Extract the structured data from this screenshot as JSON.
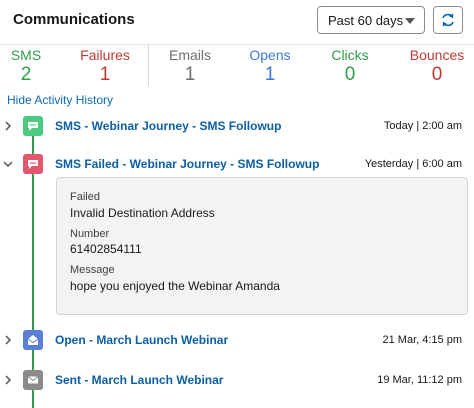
{
  "header": {
    "title": "Communications",
    "period_label": "Past 60 days"
  },
  "stats": [
    {
      "label": "SMS",
      "value": "2",
      "color": "#2e9e4b"
    },
    {
      "label": "Failures",
      "value": "1",
      "color": "#c23934"
    },
    {
      "label": "Emails",
      "value": "1",
      "color": "#706e6b"
    },
    {
      "label": "Opens",
      "value": "1",
      "color": "#3c78d8"
    },
    {
      "label": "Clicks",
      "value": "0",
      "color": "#2e9e4b"
    },
    {
      "label": "Bounces",
      "value": "0",
      "color": "#c23934"
    }
  ],
  "hide_link": "Hide Activity History",
  "activities": [
    {
      "title": "SMS - Webinar Journey - SMS Followup",
      "time": "Today | 2:00 am",
      "icon": "sms-icon",
      "color": "#4bca81",
      "expanded": false
    },
    {
      "title": "SMS Failed - Webinar Journey - SMS Followup",
      "time": "Yesterday | 6:00 am",
      "icon": "sms-failed-icon",
      "color": "#e3566b",
      "expanded": true
    },
    {
      "title": "Open - March Launch Webinar",
      "time": "21 Mar, 4:15 pm",
      "icon": "email-open-icon",
      "color": "#5b7fd6",
      "expanded": false
    },
    {
      "title": "Sent - March Launch Webinar",
      "time": "19 Mar, 11:12 pm",
      "icon": "email-icon",
      "color": "#8a8a8a",
      "expanded": false
    }
  ],
  "detail": {
    "status_label": "Failed",
    "status_value": "Invalid Destination Address",
    "number_label": "Number",
    "number_value": "61402854111",
    "message_label": "Message",
    "message_value": "hope you enjoyed the Webinar Amanda"
  }
}
